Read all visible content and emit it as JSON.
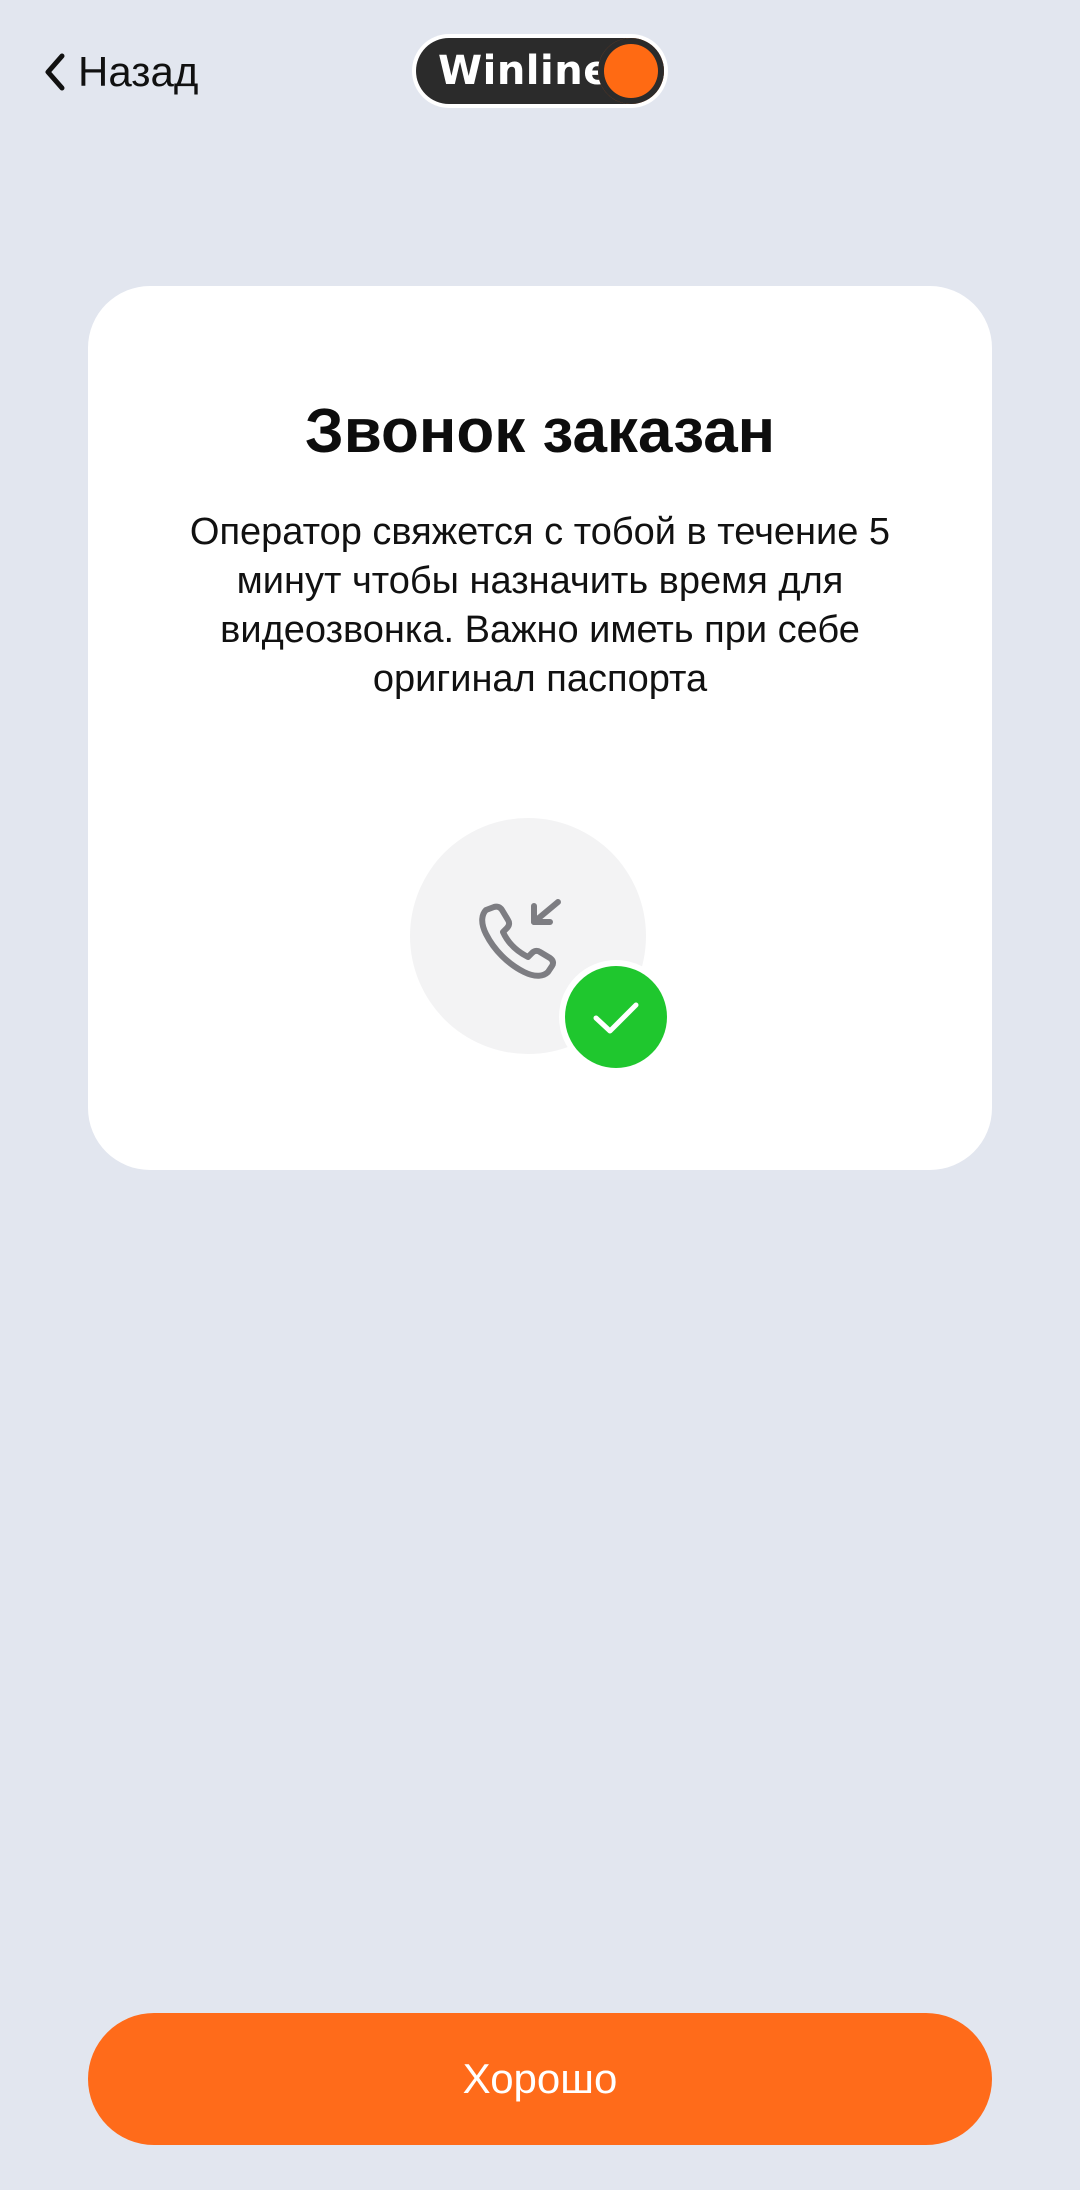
{
  "header": {
    "back_label": "Назад",
    "logo_text": "Winline"
  },
  "card": {
    "title": "Звонок заказан",
    "text": "Оператор свяжется с тобой в течение 5 минут чтобы назначить время для видеозвонка. Важно иметь при себе оригинал паспорта",
    "illustration_icons": [
      "incoming-call-icon",
      "checkmark-icon"
    ]
  },
  "footer": {
    "ok_label": "Хорошо"
  },
  "colors": {
    "background": "#e2e6ef",
    "card": "#ffffff",
    "accent": "#ff6b1a",
    "success": "#1fc72e",
    "logo_dark": "#2b2b2b"
  }
}
